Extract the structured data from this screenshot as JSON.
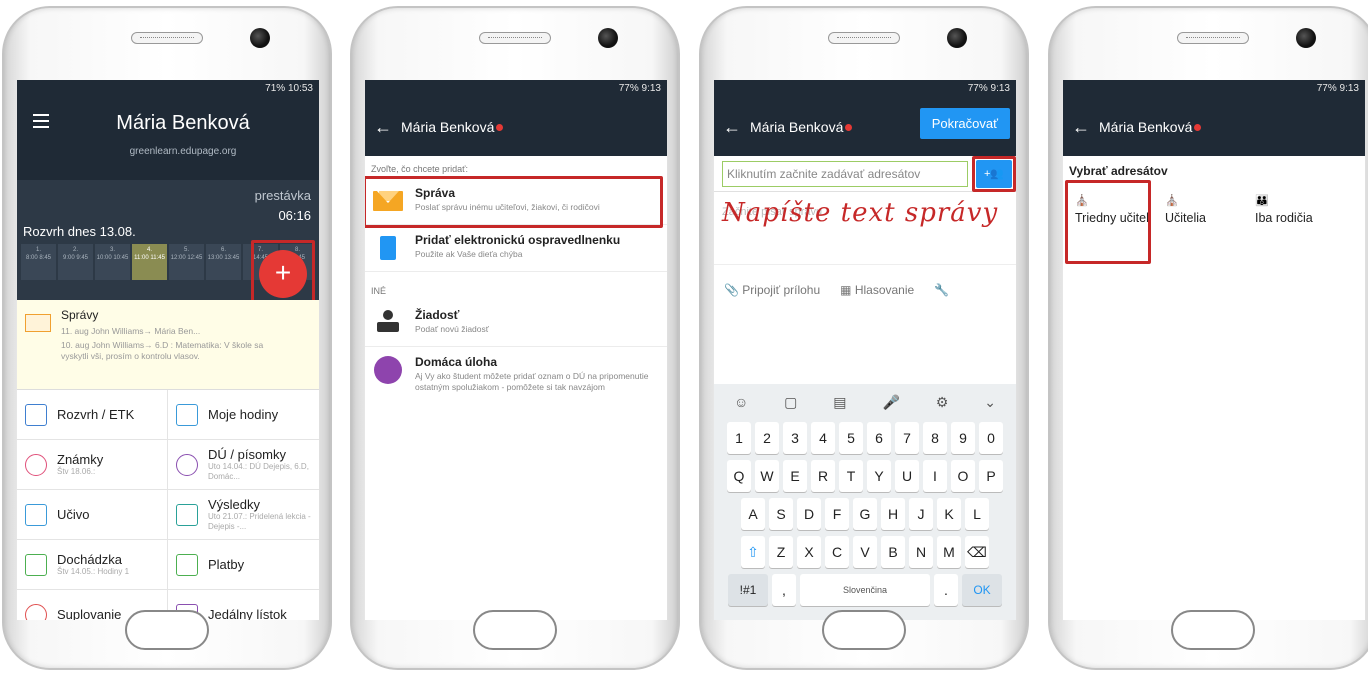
{
  "colors": {
    "dark_header": "#1f2a36",
    "accent_red": "#e53935",
    "accent_blue": "#2196f3",
    "highlight": "#c62828"
  },
  "phone1": {
    "status": "71% 10:53",
    "title": "Mária Benková",
    "subtitle": "greenlearn.edupage.org",
    "break_label": "prestávka",
    "break_time": "06:16",
    "schedule_label": "Rozvrh dnes 13.08.",
    "periods": [
      {
        "n": "1.",
        "t": "8:00 8:45"
      },
      {
        "n": "2.",
        "t": "9:00 9:45"
      },
      {
        "n": "3.",
        "t": "10:00 10:45"
      },
      {
        "n": "4.",
        "t": "11:00 11:45",
        "current": true
      },
      {
        "n": "5.",
        "t": "12:00 12:45"
      },
      {
        "n": "6.",
        "t": "13:00 13:45"
      },
      {
        "n": "7.",
        "t": "14:45"
      },
      {
        "n": "8.",
        "t": "15:45"
      }
    ],
    "fab": "+",
    "messages": {
      "title": "Správy",
      "line1": "11. aug  John Williams→ Mária Ben...",
      "line2": "10. aug  John Williams→ 6.D : Matematika: V škole sa vyskytli vši, prosím o kontrolu vlasov."
    },
    "tiles": [
      {
        "label": "Rozvrh / ETK",
        "sub": ""
      },
      {
        "label": "Moje hodiny",
        "sub": ""
      },
      {
        "label": "Známky",
        "sub": "Štv 18.06.:"
      },
      {
        "label": "DÚ / písomky",
        "sub": "Uto 14.04.: DÚ Dejepis, 6.D, Domác..."
      },
      {
        "label": "Učivo",
        "sub": ""
      },
      {
        "label": "Výsledky",
        "sub": "Uto 21.07.: Pridelená lekcia - Dejepis -..."
      },
      {
        "label": "Dochádzka",
        "sub": "Štv 14.05.: Hodiny 1"
      },
      {
        "label": "Platby",
        "sub": ""
      },
      {
        "label": "Suplovanie",
        "sub": ""
      },
      {
        "label": "Jedálny lístok",
        "sub": ""
      }
    ]
  },
  "phone2": {
    "status": "77% 9:13",
    "back": "←",
    "title": "Mária Benková",
    "section": "Zvoľte, čo chcete pridať:",
    "items": [
      {
        "title": "Správa",
        "desc": "Poslať správu inému učiteľovi, žiakovi, či rodičovi"
      },
      {
        "title": "Pridať elektronickú ospravedlnenku",
        "desc": "Použite ak Vaše dieťa chýba"
      }
    ],
    "section2": "INÉ",
    "items2": [
      {
        "title": "Žiadosť",
        "desc": "Podať novú žiadosť"
      },
      {
        "title": "Domáca úloha",
        "desc": "Aj Vy ako študent môžete pridať oznam o DÚ na pripomenutie ostatným spolužiakom - pomôžete si tak navzájom"
      }
    ]
  },
  "phone3": {
    "status": "77% 9:13",
    "back": "←",
    "title": "Mária Benková",
    "continue": "Pokračovať",
    "addr_placeholder": "Kliknutím začnite zadávať adresátov",
    "text_placeholder": "Začnite písať správu",
    "annotation": "Napíšte text správy",
    "attach": "Pripojiť prílohu",
    "vote": "Hlasovanie",
    "kb_row1": [
      "1",
      "2",
      "3",
      "4",
      "5",
      "6",
      "7",
      "8",
      "9",
      "0"
    ],
    "kb_row2": [
      "Q",
      "W",
      "E",
      "R",
      "T",
      "Y",
      "U",
      "I",
      "O",
      "P"
    ],
    "kb_row3": [
      "A",
      "S",
      "D",
      "F",
      "G",
      "H",
      "J",
      "K",
      "L"
    ],
    "kb_row4": [
      "Z",
      "X",
      "C",
      "V",
      "B",
      "N",
      "M"
    ],
    "kb_sym": "!#1",
    "kb_comma": ",",
    "kb_space": "Slovenčina",
    "kb_dot": ".",
    "kb_ok": "OK"
  },
  "phone4": {
    "status": "77% 9:13",
    "back": "←",
    "title": "Mária Benková",
    "heading": "Vybrať adresátov",
    "options": [
      "Triedny učiteľ",
      "Učitelia",
      "Iba rodičia"
    ]
  }
}
